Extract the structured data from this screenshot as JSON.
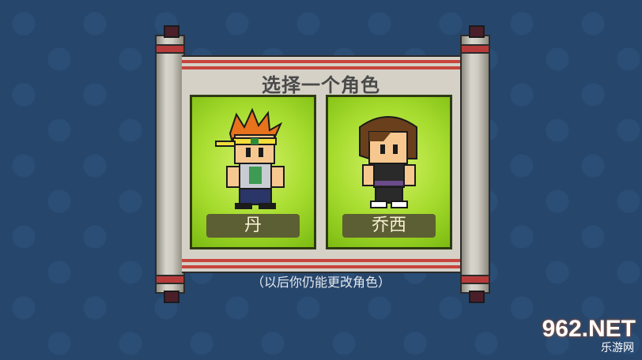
{
  "title": "选择一个角色",
  "characters": [
    {
      "name": "丹"
    },
    {
      "name": "乔西"
    }
  ],
  "hint": "（以后你仍能更改角色）",
  "watermark": {
    "top": "962.NET",
    "bottom": "乐游网"
  },
  "colors": {
    "background": "#27466c",
    "card_green": "#a6dc2e",
    "namebar": "#5c5e33",
    "scroll_paper": "#d5d1c7",
    "accent_red": "#c7453d"
  }
}
